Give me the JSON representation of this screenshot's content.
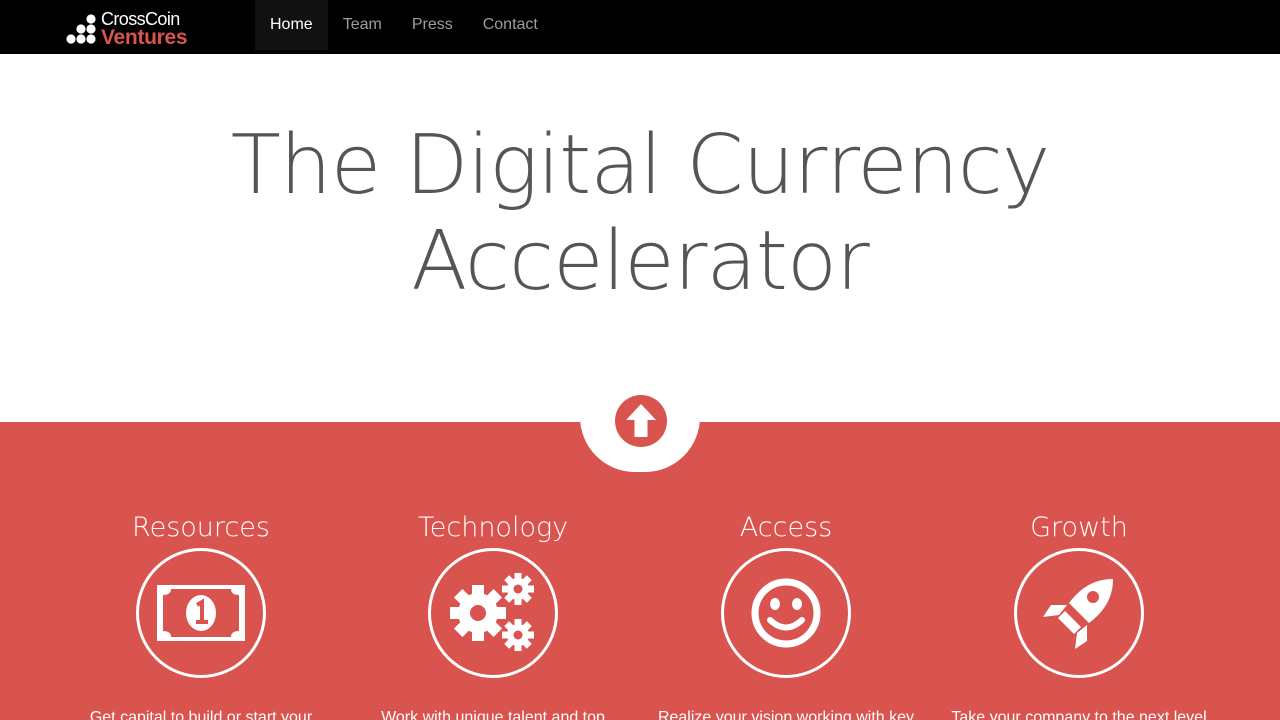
{
  "brand": {
    "line1": "CrossCoin",
    "line2": "Ventures"
  },
  "nav": {
    "items": [
      {
        "label": "Home",
        "active": true
      },
      {
        "label": "Team",
        "active": false
      },
      {
        "label": "Press",
        "active": false
      },
      {
        "label": "Contact",
        "active": false
      }
    ]
  },
  "hero": {
    "line1": "The Digital Currency",
    "line2": "Accelerator"
  },
  "scroll_button": {
    "icon": "arrow-circle-up-icon"
  },
  "features": [
    {
      "title": "Resources",
      "icon": "money-icon",
      "description": "Get capital to build or start your"
    },
    {
      "title": "Technology",
      "icon": "gears-icon",
      "description": "Work with unique talent and top"
    },
    {
      "title": "Access",
      "icon": "smile-icon",
      "description": "Realize your vision working with key"
    },
    {
      "title": "Growth",
      "icon": "rocket-icon",
      "description": "Take your company to the next level"
    }
  ],
  "colors": {
    "accent": "#d9534f",
    "navbar": "#000000",
    "heading": "#555555"
  }
}
